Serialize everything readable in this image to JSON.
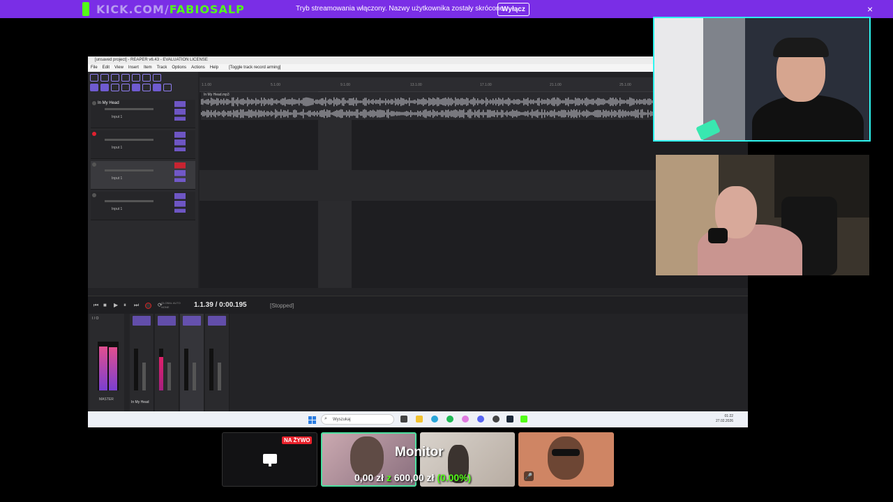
{
  "overlay": {
    "channel_prefix": "KICK.COM/",
    "channel_name": "FABIOSALP",
    "notice": "Tryb streamowania włączony. Nazwy użytkownika zostały skrócone.",
    "disable_button": "Wyłącz",
    "close_icon": "×"
  },
  "reaper": {
    "title": "[unsaved project] - REAPER v6.43 - EVALUATION LICENSE",
    "menu": [
      "File",
      "Edit",
      "View",
      "Insert",
      "Item",
      "Track",
      "Options",
      "Actions",
      "Help",
      "[Toggle track record arming]"
    ],
    "tracks": [
      {
        "name": "In My Head",
        "input": "Input 1",
        "armed": false
      },
      {
        "name": "",
        "input": "Input 1",
        "armed": true
      },
      {
        "name": "",
        "input": "Input 1",
        "armed": false,
        "selected": true
      },
      {
        "name": "",
        "input": "Input 1",
        "armed": false
      }
    ],
    "item_label": "In My Head.mp3",
    "ruler_ticks": [
      "1.1.00",
      "5.1.00",
      "9.1.00",
      "13.1.00",
      "17.1.00",
      "21.1.00",
      "25.1.00"
    ],
    "transport": {
      "time": "1.1.39 / 0:00.195",
      "state": "[Stopped]",
      "mini_labels": "GLOBAL AUTO\nNONE"
    },
    "mixer": {
      "master_label": "MASTER",
      "track_name": "In My Head",
      "io_label": "I / O"
    },
    "taskbar": {
      "search_placeholder": "Wyszukaj",
      "time": "01:22",
      "date": "27.02.2026"
    }
  },
  "cards": {
    "live_badge": "NA ŻYWO",
    "goal_title": "Monitor",
    "goal_current": "0,00 zł",
    "goal_conj": "z",
    "goal_target": "600,00 zł",
    "goal_percent": "(0.00%)"
  },
  "colors": {
    "kick_green": "#53fc18",
    "overlay_purple": "#7a2ee6",
    "cam_border": "#2ef6f0",
    "live_red": "#e8212b"
  }
}
